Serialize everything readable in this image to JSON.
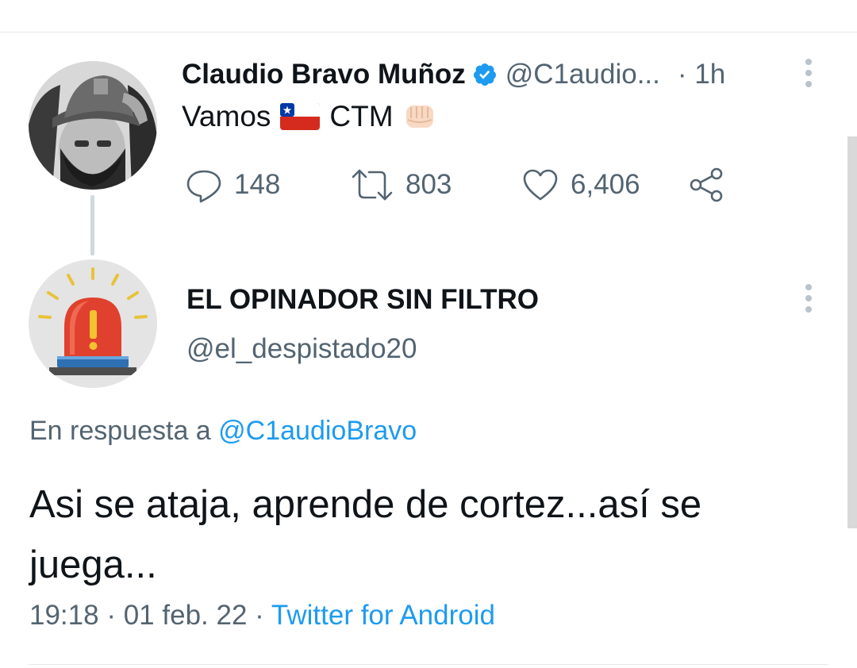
{
  "original_tweet": {
    "display_name": "Claudio Bravo Muñoz",
    "handle": "@C1audio...",
    "time": "· 1h",
    "text_before": "Vamos",
    "text_after": "CTM",
    "flag_emoji": "chile-flag-icon",
    "fist_emoji": "fist-icon",
    "stats": {
      "replies": "148",
      "retweets": "803",
      "likes": "6,406"
    }
  },
  "reply_tweet": {
    "display_name": "EL OPINADOR SIN FILTRO",
    "handle": "@el_despistado20",
    "replying_prefix": "En respuesta a",
    "replying_to": "@C1audioBravo",
    "text": "Asi se ataja, aprende de cortez...así se juega...",
    "time": "19:18",
    "separator": "·",
    "date": "01 feb. 22",
    "source_separator": "·",
    "source": "Twitter for Android"
  },
  "colors": {
    "accent": "#1d9bf0",
    "secondary_text": "#536471",
    "primary_text": "#0f1419"
  }
}
